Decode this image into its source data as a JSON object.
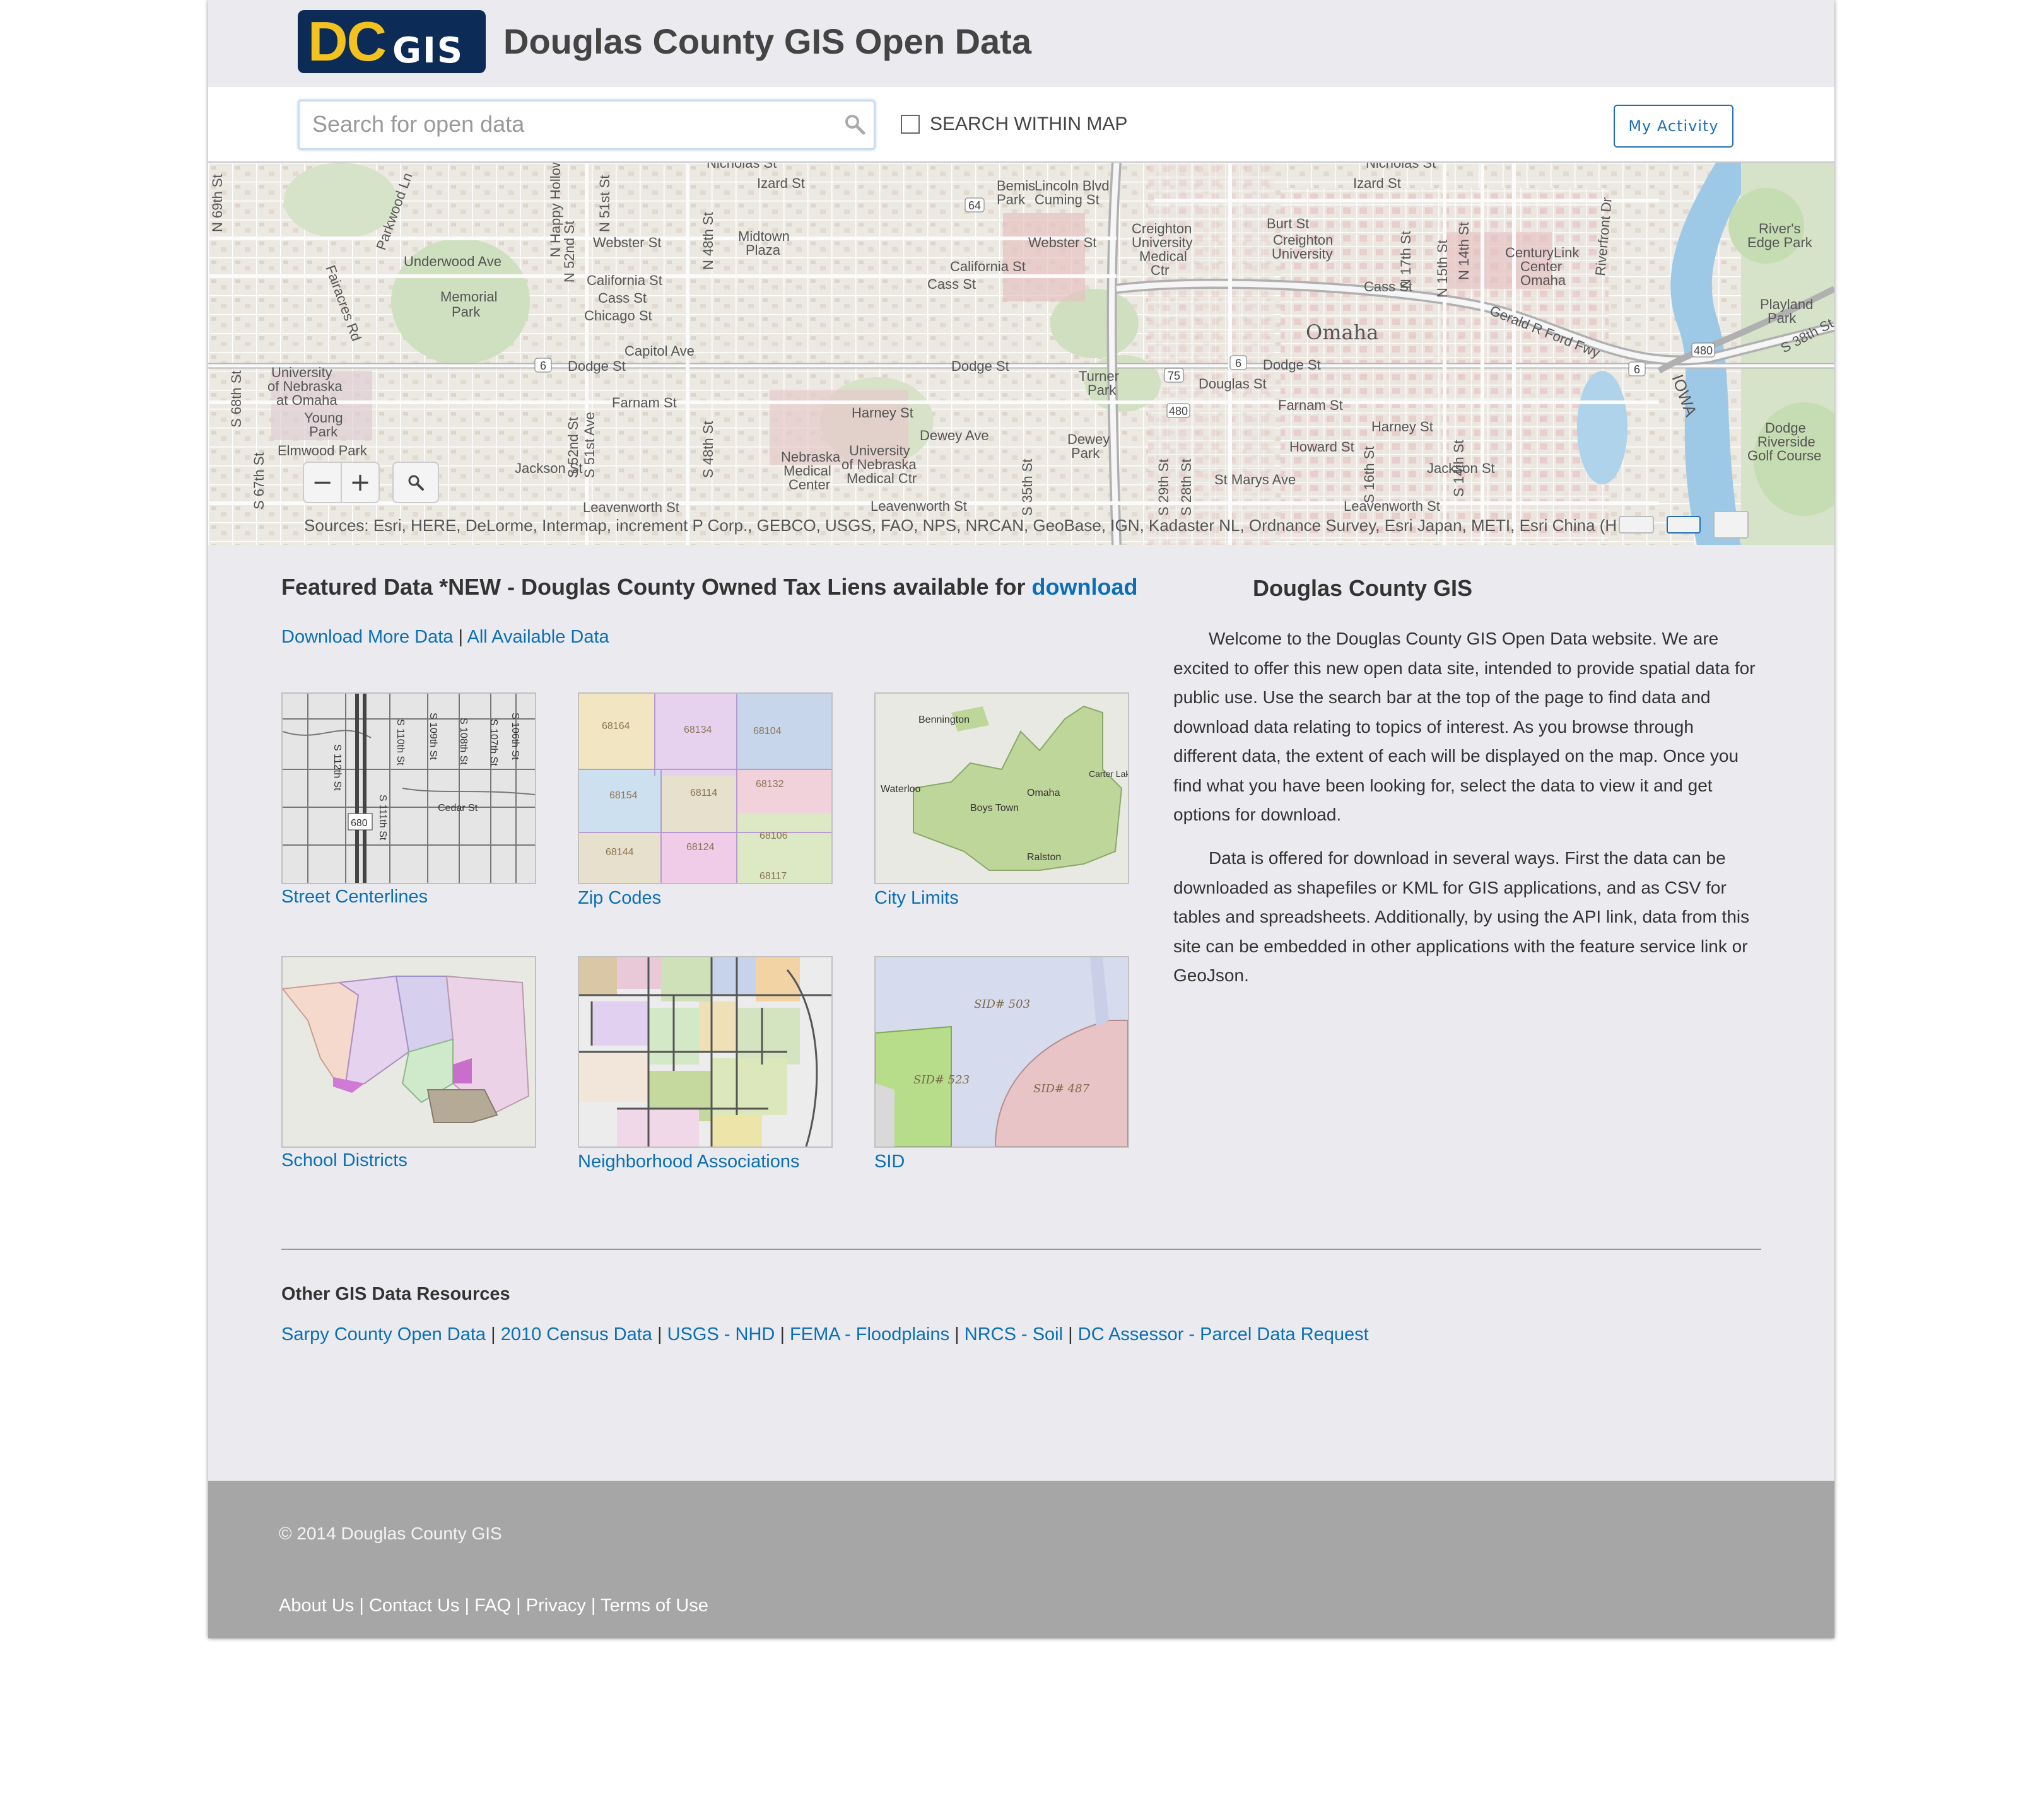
{
  "header": {
    "logo_dc": "DC",
    "logo_gis": "GIS",
    "title": "Douglas County GIS Open Data"
  },
  "search": {
    "placeholder": "Search for open data",
    "value": "",
    "within_map_label": "SEARCH WITHIN MAP",
    "within_map_checked": false,
    "my_activity_label": "My Activity"
  },
  "map": {
    "attribution": "Sources: Esri, HERE, DeLorme, Intermap, increment P Corp., GEBCO, USGS, FAO, NPS, NRCAN, GeoBase, IGN, Kadaster NL, Ordnance Survey, Esri Japan, METI, Esri China (H",
    "zoom_out": "−",
    "zoom_in": "+",
    "labels": {
      "nicholas_l": "Nicholas St",
      "nicholas_r": "Nicholas St",
      "izard_l": "Izard St",
      "izard_r": "Izard St",
      "lincoln": "Lincoln Blvd",
      "cuming": "Cuming St",
      "bemis": "Bemis",
      "bemis_park": "Park",
      "webster_l": "Webster St",
      "webster_r": "Webster St",
      "underwood": "Underwood Ave",
      "midtown": "Midtown",
      "plaza": "Plaza",
      "california_l": "California St",
      "california_r": "California St",
      "cass_l": "Cass St",
      "cass_m": "Cass St",
      "cass_r": "Cass St",
      "chicago": "Chicago St",
      "memorial": "Memorial",
      "memorial_park": "Park",
      "capitol": "Capitol Ave",
      "dodge_l": "Dodge St",
      "dodge_m": "Dodge St",
      "dodge_r": "Dodge St",
      "douglas": "Douglas St",
      "farnam_l": "Farnam St",
      "farnam_r": "Farnam St",
      "harney_l": "Harney St",
      "harney_r": "Harney St",
      "dewey_l": "Dewey Ave",
      "howard": "Howard St",
      "jackson_l": "Jackson St",
      "jackson_r": "Jackson St",
      "leavenworth_l": "Leavenworth St",
      "leavenworth_m": "Leavenworth St",
      "leavenworth_r": "Leavenworth St",
      "st_marys": "St Marys Ave",
      "omaha": "Omaha",
      "iowa": "IOWA",
      "uno_1": "University",
      "uno_2": "of Nebraska",
      "uno_3": "at Omaha",
      "young": "Young",
      "young_park": "Park",
      "elmwood": "Elmwood Park",
      "nmc_1": "Nebraska",
      "nmc_2": "Medical",
      "nmc_3": "Center",
      "unmc_1": "University",
      "unmc_2": "of Nebraska",
      "unmc_3": "Medical Ctr",
      "cu_med_1": "Creighton",
      "cu_med_2": "University",
      "cu_med_3": "Medical",
      "cu_med_4": "Ctr",
      "burt": "Burt St",
      "cu_1": "Creighton",
      "cu_2": "University",
      "centurylink_1": "CenturyLink",
      "centurylink_2": "Center",
      "centurylink_3": "Omaha",
      "rivers_edge_1": "River's",
      "rivers_edge_2": "Edge Park",
      "playland_1": "Playland",
      "playland_2": "Park",
      "dodge_riverside_1": "Dodge",
      "dodge_riverside_2": "Riverside",
      "dodge_riverside_3": "Golf Course",
      "gerald_ford": "Gerald R Ford Fwy",
      "turner": "Turner",
      "turner_park": "Park",
      "dewey_park": "Dewey",
      "dewey_park_2": "Park",
      "s38th": "S 38th St",
      "n52nd": "N 52nd St",
      "n51st": "N 51st St",
      "n48th": "N 48th St",
      "n_happy": "N Happy Hollow",
      "n17th": "N 17th St",
      "n15th": "N 15th St",
      "n14th": "N 14th St",
      "s52nd": "S 52nd St",
      "s51st": "S 51st Ave",
      "s48th": "S 48th St",
      "s67th": "S 67th St",
      "s68th": "S 68th St",
      "s35th": "S 35th St",
      "s29th": "S 29th St",
      "s28th": "S 28th St",
      "s16th": "S 16th St",
      "s14th": "S 14th St",
      "n69th": "N 69th St",
      "fairacres": "Fairacres Rd",
      "parkwood": "Parkwood Ln",
      "riverfront": "Riverfront Dr",
      "shield_6_l": "6",
      "shield_6_m": "6",
      "shield_6_r": "6",
      "shield_64": "64",
      "shield_75": "75",
      "shield_480_s": "480",
      "shield_480_e": "480"
    }
  },
  "featured": {
    "title_prefix": "Featured Data *NEW - Douglas County Owned Tax Liens available for ",
    "title_link": "download",
    "download_more": "Download More Data",
    "separator": "|",
    "all_available": "All Available Data",
    "tiles": [
      {
        "label": "Street Centerlines",
        "map_text": [
          "S 112th St",
          "S 110th St",
          "S 109th St",
          "S 108th St",
          "S 107th St",
          "S 106th St",
          "S 111th St",
          "Cedar St",
          "680"
        ]
      },
      {
        "label": "Zip Codes",
        "map_text": [
          "68164",
          "68134",
          "68104",
          "68154",
          "68114",
          "68132",
          "68144",
          "68124",
          "68106",
          "68117"
        ]
      },
      {
        "label": "City Limits",
        "map_text": [
          "Bennington",
          "Waterloo",
          "Omaha",
          "Carter Lake, Iowa",
          "Boys Town",
          "Ralston"
        ]
      },
      {
        "label": "School Districts",
        "map_text": []
      },
      {
        "label": "Neighborhood Associations",
        "map_text": []
      },
      {
        "label": "SID",
        "map_text": [
          "SID# 503",
          "SID# 523",
          "SID# 487"
        ]
      }
    ]
  },
  "about": {
    "title": "Douglas County GIS",
    "para1": "Welcome to the Douglas County GIS Open Data website. We are excited to offer this new open data site, intended to provide spatial data for public use. Use the search bar at the top of the page to find data and download data relating to topics of interest. As you browse through different data, the extent of each will be displayed on the map. Once you find what you have been looking for, select the data to view it and get options for download.",
    "para2": "Data is offered for download in several ways. First the data can be downloaded as shapefiles or KML for GIS applications, and as CSV for tables and spreadsheets. Additionally, by using the API link, data from this site can be embedded in other applications with the feature service link or GeoJson."
  },
  "other_resources": {
    "title": "Other GIS Data Resources",
    "separator": "|",
    "links": [
      "Sarpy County Open Data",
      "2010 Census Data",
      "USGS - NHD",
      "FEMA - Floodplains",
      "NRCS - Soil",
      "DC Assessor - Parcel Data Request"
    ]
  },
  "footer": {
    "copyright": "© 2014 Douglas County GIS",
    "separator": "|",
    "links": [
      "About Us",
      "Contact Us",
      "FAQ",
      "Privacy",
      "Terms of Use"
    ]
  },
  "colors": {
    "link": "#0a6fb6",
    "logo_bg": "#0c2b57",
    "logo_dc": "#f4c21f",
    "footer_bg": "#a6a6a6",
    "page_bg": "#ebebef",
    "activity_button": "#1e6fb8"
  },
  "icons": {
    "search": "search-icon",
    "map_search": "magnifier-icon",
    "checkbox": "checkbox-icon"
  }
}
